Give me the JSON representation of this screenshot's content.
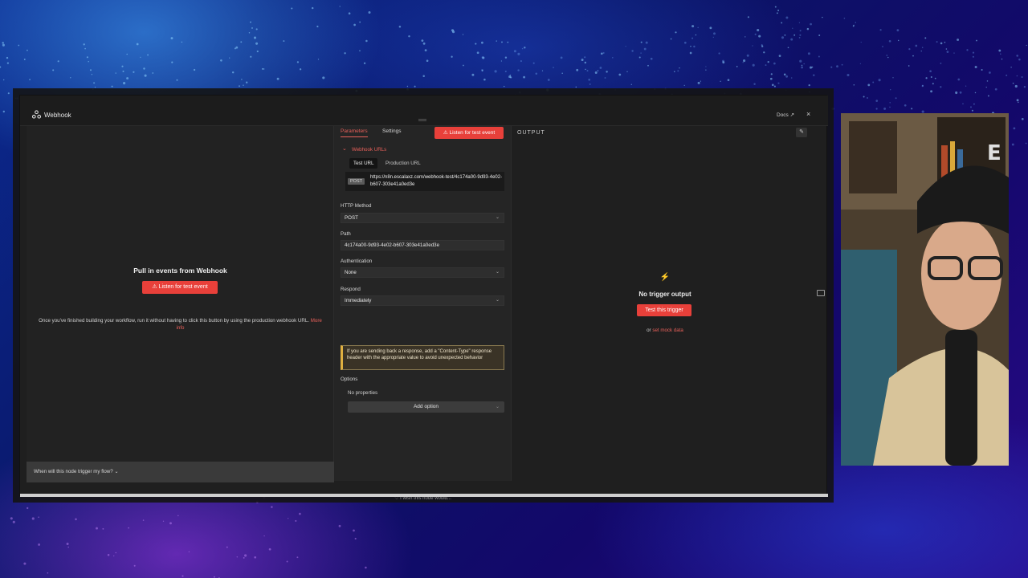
{
  "window": {
    "title": "Webhook",
    "docs_label": "Docs",
    "close_label": "×"
  },
  "left_panel": {
    "title": "Pull in events from Webhook",
    "listen_button": "Listen for test event",
    "description": "Once you've finished building your workflow, run it without having to click this button by using the production webhook URL.",
    "more_info": "More info",
    "footer_question": "When will this node trigger my flow?"
  },
  "params": {
    "tabs": [
      "Parameters",
      "Settings"
    ],
    "listen_button": "Listen for test event",
    "section_title": "Webhook URLs",
    "url_tabs": [
      "Test URL",
      "Production URL"
    ],
    "url_method": "POST",
    "url_value": "https://n8n.escalaxz.com/webhook-test/4c174a00-9d93-4e02-b607-303e41a0ed3e",
    "http_method_label": "HTTP Method",
    "http_method_value": "POST",
    "path_label": "Path",
    "path_value": "4c174a00-9d93-4e02-b607-303e41a0ed3e",
    "auth_label": "Authentication",
    "auth_value": "None",
    "respond_label": "Respond",
    "respond_value": "Immediately",
    "notice": "If you are sending back a response, add a \"Content-Type\" response header with the appropriate value to avoid unexpected behavior",
    "options_label": "Options",
    "no_properties": "No properties",
    "add_option": "Add option",
    "wish": "I wish this node would..."
  },
  "output": {
    "label": "OUTPUT",
    "no_output": "No trigger output",
    "test_button": "Test this trigger",
    "or_text": "or",
    "mock_link": "set mock data"
  },
  "colors": {
    "accent": "#e8403a",
    "panel": "#1f1f1f",
    "notice_border": "#e0b040"
  },
  "icons": [
    "webhook-icon",
    "external-link-icon",
    "close-icon",
    "chevron-down-icon",
    "lightning-icon",
    "pencil-icon",
    "pin-icon"
  ]
}
